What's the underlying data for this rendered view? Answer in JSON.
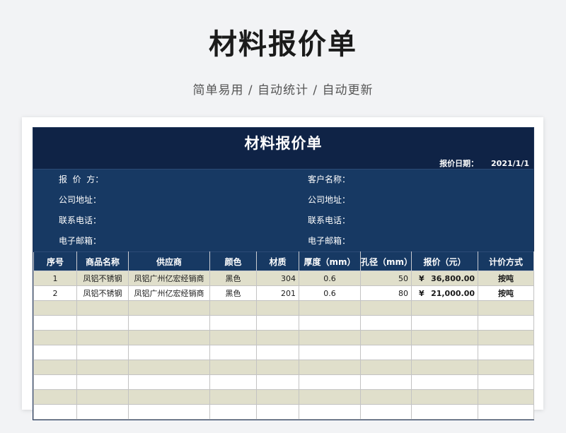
{
  "page": {
    "title": "材料报价单",
    "subtitle": "简单易用 / 自动统计 / 自动更新"
  },
  "sheet": {
    "title": "材料报价单",
    "date_label": "报价日期：",
    "date_value": "2021/1/1",
    "info": {
      "quoter_label": "报  价  方：",
      "customer_label": "客户名称：",
      "address_left_label": "公司地址：",
      "address_right_label": "公司地址：",
      "phone_left_label": "联系电话：",
      "phone_right_label": "联系电话：",
      "email_left_label": "电子邮箱：",
      "email_right_label": "电子邮箱："
    },
    "columns": [
      "序号",
      "商品名称",
      "供应商",
      "颜色",
      "材质",
      "厚度（mm）",
      "孔径（mm）",
      "报价（元）",
      "计价方式"
    ],
    "rows": [
      {
        "no": "1",
        "name": "凤铝不锈钢",
        "supplier": "凤铝广州亿宏经销商",
        "color": "黑色",
        "material": "304",
        "thickness": "0.6",
        "aperture": "50",
        "currency": "¥",
        "price": "36,800.00",
        "mode": "按吨"
      },
      {
        "no": "2",
        "name": "凤铝不锈钢",
        "supplier": "凤铝广州亿宏经销商",
        "color": "黑色",
        "material": "201",
        "thickness": "0.6",
        "aperture": "80",
        "currency": "¥",
        "price": "21,000.00",
        "mode": "按吨"
      }
    ]
  },
  "colors": {
    "header_dark": "#0f2346",
    "header_blue": "#173963",
    "stripe": "#e0dfcb",
    "price_red": "#c00000"
  }
}
